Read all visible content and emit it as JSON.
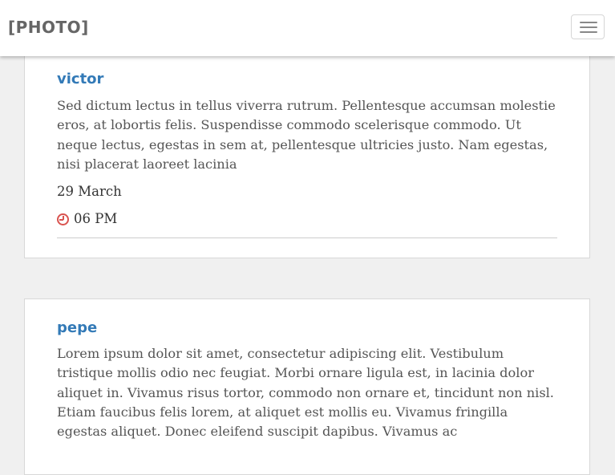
{
  "navbar": {
    "brand": "[PHOTO]",
    "toggle_icon": "hamburger-menu-icon"
  },
  "posts": [
    {
      "author": "victor",
      "body": "Sed dictum lectus in tellus viverra rutrum. Pellentesque accumsan molestie eros, at lobortis felis. Suspendisse commodo scelerisque commodo. Ut neque lectus, egestas in sem at, pellentesque ultricies justo. Nam egestas, nisi placerat laoreet lacinia",
      "date": "29 March",
      "time": "06 PM",
      "time_icon": "clock-icon"
    },
    {
      "author": "pepe",
      "body": "Lorem ipsum dolor sit amet, consectetur adipiscing elit. Vestibulum tristique mollis odio nec feugiat. Morbi ornare ligula est, in lacinia dolor aliquet in. Vivamus risus tortor, commodo non ornare et, tincidunt non nisl. Etiam faucibus felis lorem, at aliquet est mollis eu. Vivamus fringilla egestas aliquet. Donec eleifend suscipit dapibus. Vivamus ac"
    }
  ],
  "colors": {
    "link": "#337ab7",
    "icon_accent": "#d9534f",
    "background": "#f0f0f0"
  }
}
